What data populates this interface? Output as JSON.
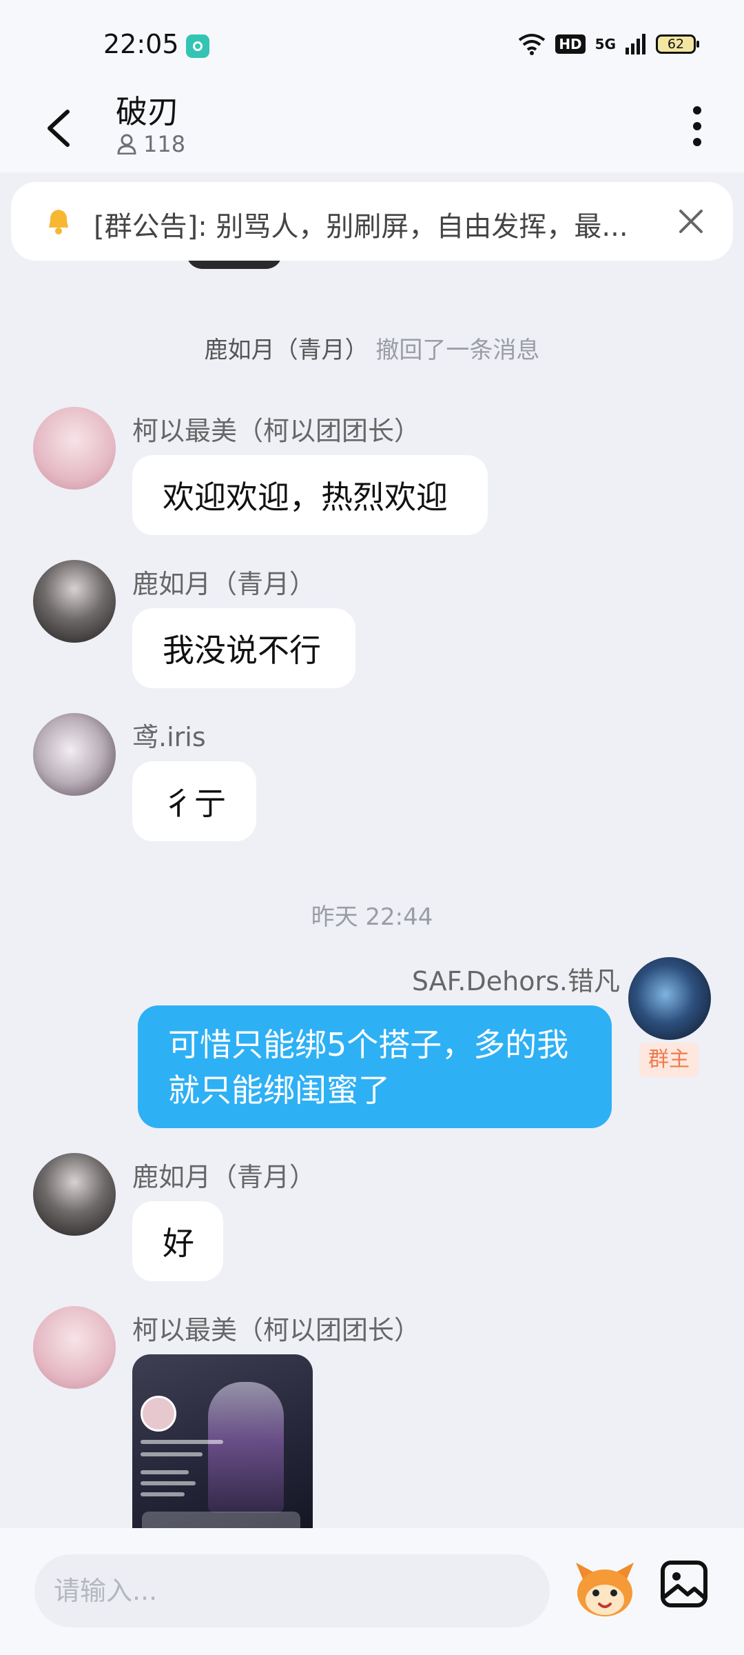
{
  "status_bar": {
    "time": "22:05",
    "network": "5G",
    "hd": "HD",
    "battery": "62"
  },
  "header": {
    "title": "破刃",
    "member_count": "118"
  },
  "notice": {
    "text": "[群公告]: 别骂人，别刷屏，自由发挥，最..."
  },
  "system_message": {
    "who": "鹿如月（青月）",
    "action": "撤回了一条消息"
  },
  "timestamp": "昨天 22:44",
  "messages": [
    {
      "sender": "柯以最美（柯以团团长）",
      "text": "欢迎欢迎，热烈欢迎"
    },
    {
      "sender": "鹿如月（青月）",
      "text": "我没说不行"
    },
    {
      "sender": "鸢.iris",
      "text": "彳亍"
    },
    {
      "sender": "SAF.Dehors.错凡",
      "text": "可惜只能绑5个搭子，多的我就只能绑闺蜜了",
      "badge": "群主"
    },
    {
      "sender": "鹿如月（青月）",
      "text": "好"
    },
    {
      "sender": "柯以最美（柯以团团长）"
    }
  ],
  "input": {
    "placeholder": "请输入..."
  },
  "colors": {
    "self_bubble": "#2eb0f5",
    "owner_badge_bg": "#fde7df",
    "owner_badge_text": "#f27a4b"
  }
}
